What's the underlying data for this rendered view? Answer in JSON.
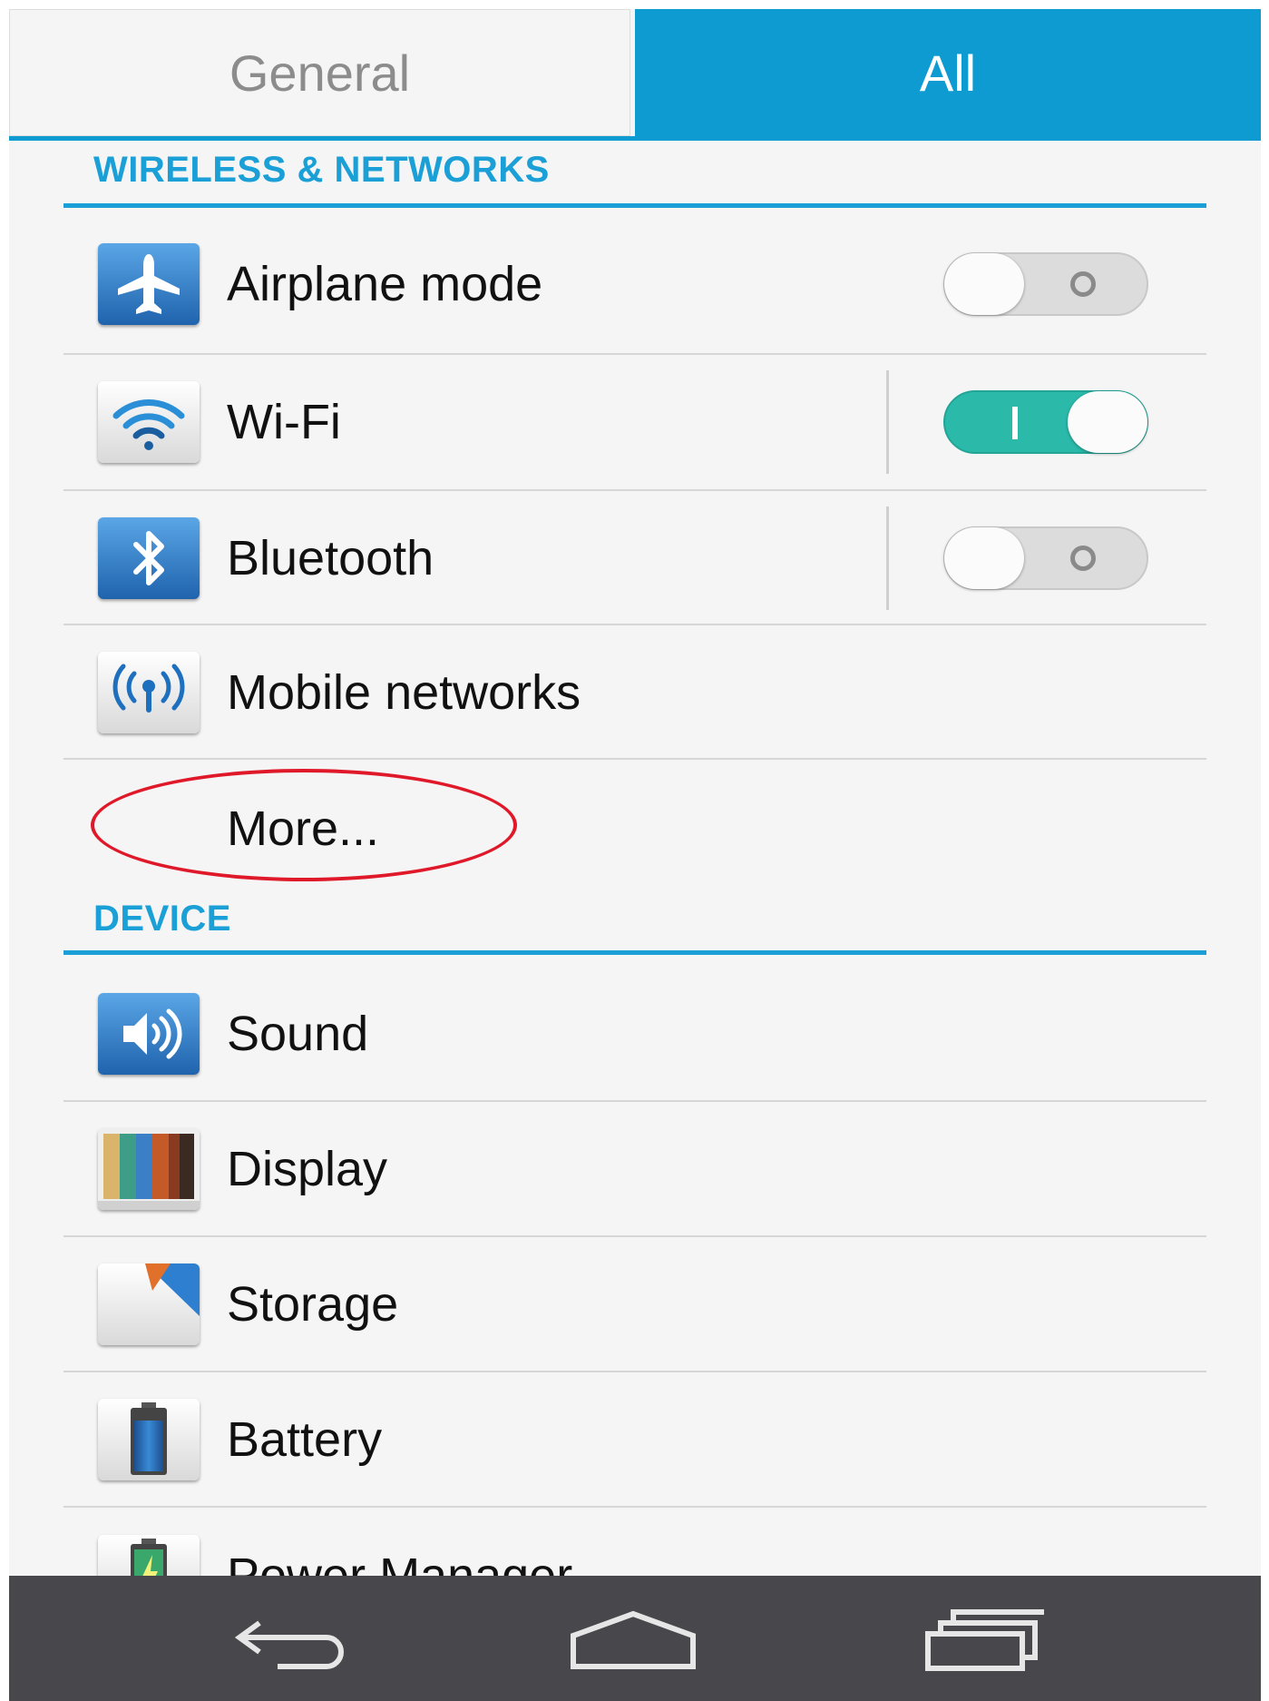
{
  "tabs": [
    {
      "label": "General",
      "selected": false
    },
    {
      "label": "All",
      "selected": true
    }
  ],
  "sections": {
    "wireless": {
      "header": "WIRELESS & NETWORKS",
      "items": [
        {
          "label": "Airplane mode",
          "icon": "airplane-icon",
          "toggle": "off"
        },
        {
          "label": "Wi-Fi",
          "icon": "wifi-icon",
          "toggle": "on"
        },
        {
          "label": "Bluetooth",
          "icon": "bluetooth-icon",
          "toggle": "off"
        },
        {
          "label": "Mobile networks",
          "icon": "mobile-networks-icon"
        },
        {
          "label": "More..."
        }
      ]
    },
    "device": {
      "header": "DEVICE",
      "items": [
        {
          "label": "Sound",
          "icon": "sound-icon"
        },
        {
          "label": "Display",
          "icon": "display-icon"
        },
        {
          "label": "Storage",
          "icon": "storage-icon"
        },
        {
          "label": "Battery",
          "icon": "battery-icon"
        },
        {
          "label": "Power Manager",
          "icon": "power-manager-icon"
        }
      ]
    }
  },
  "navbar": {
    "buttons": [
      "back-icon",
      "home-icon",
      "recents-icon"
    ]
  },
  "colors": {
    "accent": "#0d9bd1",
    "toggle_on": "#2bb9a9",
    "annotation": "#e0192a",
    "navbar": "#48484c"
  }
}
